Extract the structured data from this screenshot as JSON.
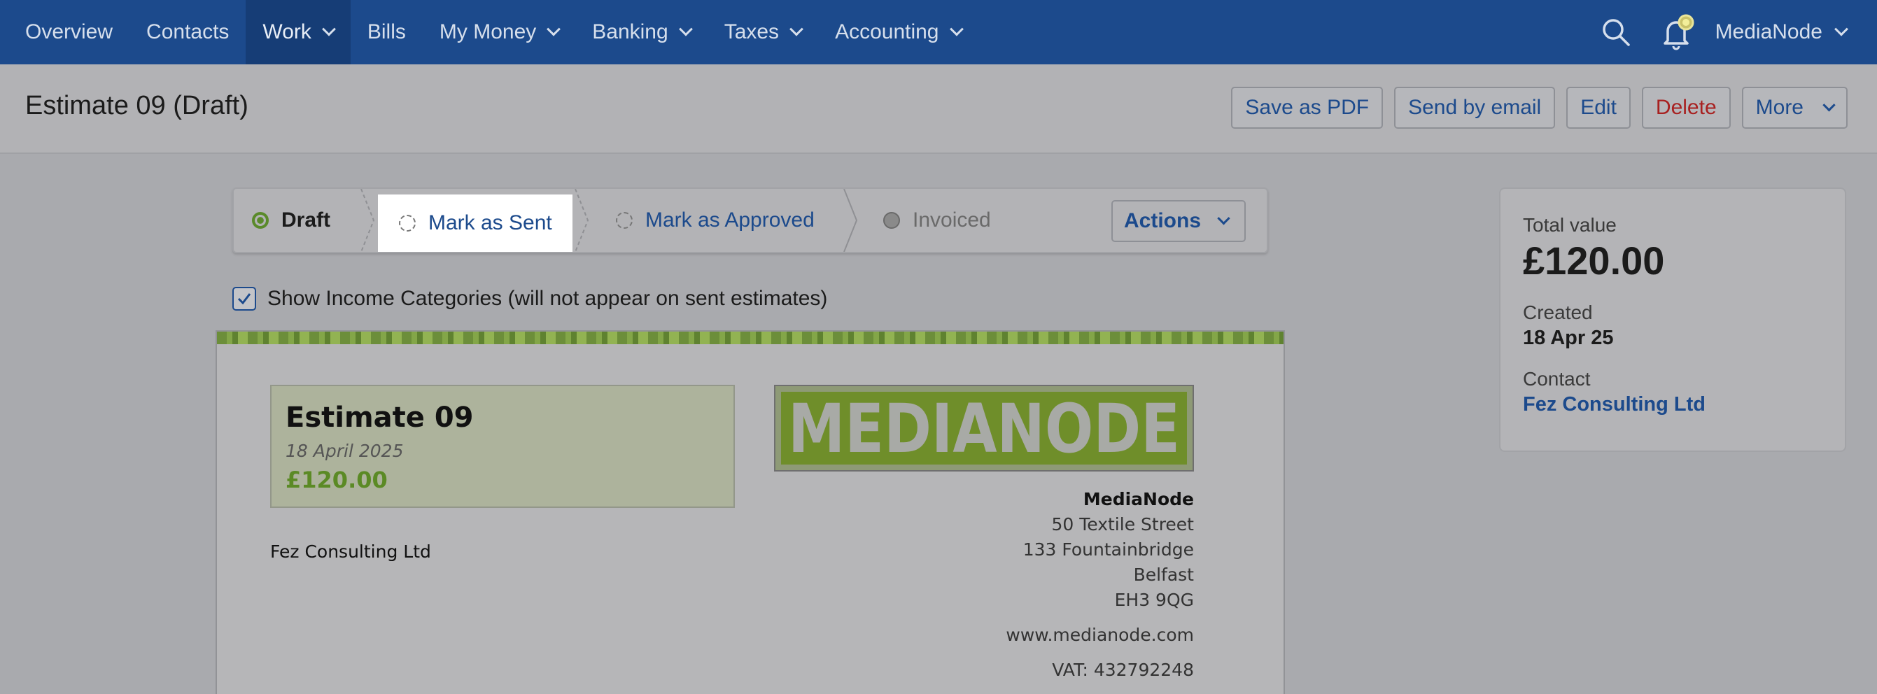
{
  "nav": {
    "items": [
      {
        "label": "Overview"
      },
      {
        "label": "Contacts"
      },
      {
        "label": "Work"
      },
      {
        "label": "Bills"
      },
      {
        "label": "My Money"
      },
      {
        "label": "Banking"
      },
      {
        "label": "Taxes"
      },
      {
        "label": "Accounting"
      }
    ],
    "org": "MediaNode"
  },
  "header": {
    "title": "Estimate 09 (Draft)",
    "actions": {
      "pdf": "Save as PDF",
      "email": "Send by email",
      "edit": "Edit",
      "delete": "Delete",
      "more": "More"
    }
  },
  "stepper": {
    "draft": "Draft",
    "sent": "Mark as Sent",
    "approved": "Mark as Approved",
    "invoiced": "Invoiced",
    "actions": "Actions"
  },
  "categories_toggle": {
    "label": "Show Income Categories (will not appear on sent estimates)",
    "checked": true
  },
  "estimate": {
    "title": "Estimate 09",
    "date": "18 April 2025",
    "amount": "£120.00",
    "client": "Fez Consulting Ltd",
    "logo_text": "MEDIANODE",
    "company": {
      "name": "MediaNode",
      "street": "50 Textile Street",
      "line2": "133 Fountainbridge",
      "city": "Belfast",
      "postcode": "EH3 9QG",
      "website": "www.medianode.com",
      "vat": "VAT: 432792248"
    }
  },
  "summary": {
    "total_label": "Total value",
    "total": "£120.00",
    "created_label": "Created",
    "created": "18 Apr 25",
    "contact_label": "Contact",
    "contact": "Fez Consulting Ltd"
  },
  "colors": {
    "nav_bg": "#1c4a8c",
    "link": "#1c4a8c",
    "danger": "#a82020",
    "accent_green": "#5b8a25"
  }
}
